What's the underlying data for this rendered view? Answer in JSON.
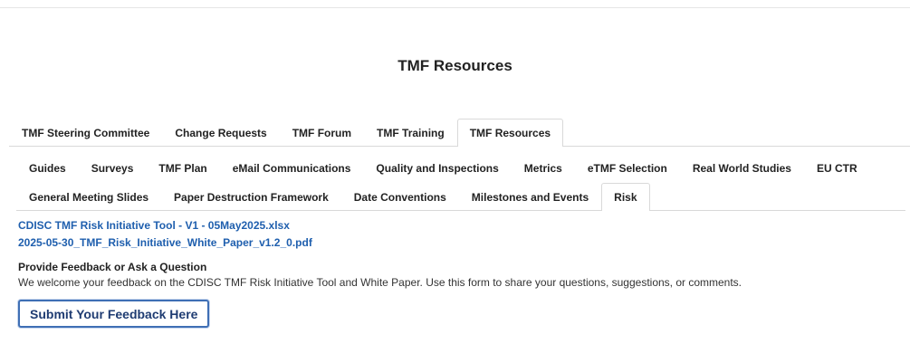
{
  "page": {
    "title": "TMF Resources"
  },
  "tabs": {
    "primary": [
      {
        "label": "TMF Steering Committee",
        "active": false
      },
      {
        "label": "Change Requests",
        "active": false
      },
      {
        "label": "TMF Forum",
        "active": false
      },
      {
        "label": "TMF Training",
        "active": false
      },
      {
        "label": "TMF Resources",
        "active": true
      }
    ],
    "secondary": [
      {
        "label": "Guides",
        "active": false
      },
      {
        "label": "Surveys",
        "active": false
      },
      {
        "label": "TMF Plan",
        "active": false
      },
      {
        "label": "eMail Communications",
        "active": false
      },
      {
        "label": "Quality and Inspections",
        "active": false
      },
      {
        "label": "Metrics",
        "active": false
      },
      {
        "label": "eTMF Selection",
        "active": false
      },
      {
        "label": "Real World Studies",
        "active": false
      },
      {
        "label": "EU CTR",
        "active": false
      }
    ],
    "tertiary": [
      {
        "label": "General Meeting Slides",
        "active": false
      },
      {
        "label": "Paper Destruction Framework",
        "active": false
      },
      {
        "label": "Date Conventions",
        "active": false
      },
      {
        "label": "Milestones and Events",
        "active": false
      },
      {
        "label": "Risk",
        "active": true
      }
    ]
  },
  "content": {
    "files": [
      {
        "label": "CDISC TMF Risk Initiative Tool - V1 - 05May2025.xlsx"
      },
      {
        "label": "2025-05-30_TMF_Risk_Initiative_White_Paper_v1.2_0.pdf"
      }
    ],
    "feedback": {
      "heading": "Provide Feedback or Ask a Question",
      "text": "We welcome your feedback on the CDISC TMF Risk Initiative Tool and White Paper. Use this form to share your questions, suggestions, or comments.",
      "button_label": "Submit Your Feedback Here"
    }
  },
  "colors": {
    "link": "#1f5fae",
    "button_border": "#3f6fb5",
    "button_text": "#1f3c72",
    "tab_border": "#d9d9d9"
  }
}
